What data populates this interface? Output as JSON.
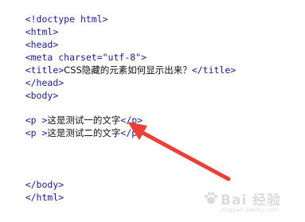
{
  "code": {
    "doctype": "<!doctype html>",
    "html_open": "<html>",
    "head_open": "<head>",
    "meta": "<meta charset=\"utf-8\">",
    "title_open": "<title>",
    "title_text": "CSS隐藏的元素如何显示出来？",
    "title_close": "</title>",
    "head_close": "</head>",
    "body_open": "<body>",
    "p_open": "<p >",
    "p1_text": "这是测试一的文字",
    "p2_text": "这是测试二的文字",
    "p_close": "</p>",
    "body_close": "</body>",
    "html_close": "</html>"
  },
  "annotation": {
    "arrow_color": "#e8413a",
    "points_to": "line-p2"
  },
  "watermark": {
    "brand": "Bai 经验",
    "sub": "jingyan.baidu.com"
  },
  "colors": {
    "tag": "#1a1a8c",
    "text": "#111111",
    "background": "#ffffff"
  }
}
